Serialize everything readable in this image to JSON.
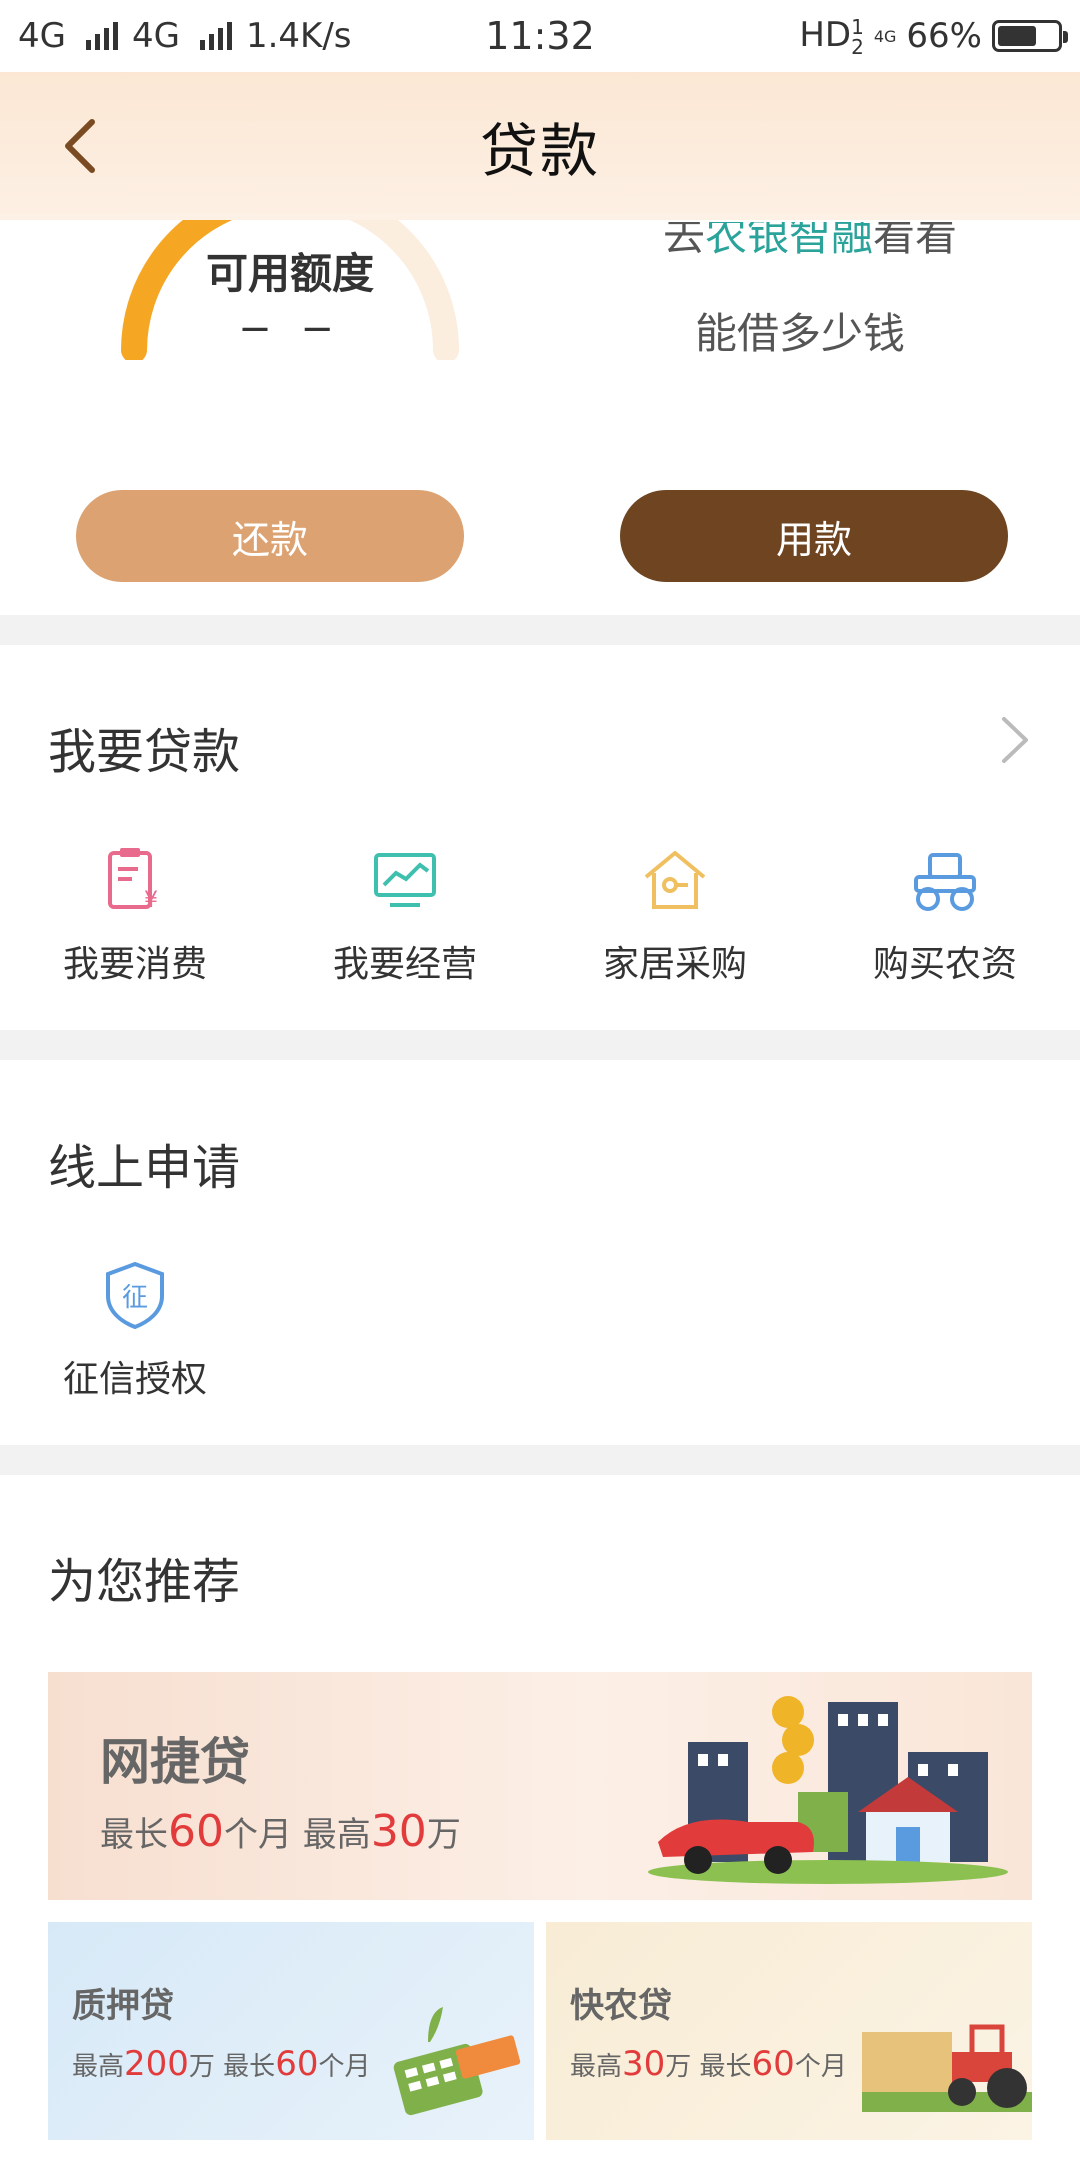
{
  "status_bar": {
    "network1": "4G",
    "network2": "4G",
    "speed": "1.4K/s",
    "time": "11:32",
    "hd": "HD",
    "hd_sup": "1",
    "hd_sub": "2",
    "net_small": "4G",
    "battery": "66%"
  },
  "header": {
    "title": "贷款"
  },
  "credit": {
    "label": "可用额度",
    "value": "− −",
    "hint_prefix": "去",
    "hint_brand": "农银智融",
    "hint_suffix": "看看",
    "hint_line2": "能借多少钱",
    "repay_label": "还款",
    "use_label": "用款",
    "repay_color": "#dca272",
    "use_color": "#6e4421"
  },
  "loan_section": {
    "title": "我要贷款",
    "items": [
      {
        "label": "我要消费",
        "icon": "consume-icon",
        "color": "#e86a8c"
      },
      {
        "label": "我要经营",
        "icon": "business-chart-icon",
        "color": "#3fbfae"
      },
      {
        "label": "家居采购",
        "icon": "house-key-icon",
        "color": "#f0c060"
      },
      {
        "label": "购买农资",
        "icon": "tractor-icon",
        "color": "#5a9be0"
      }
    ]
  },
  "online_section": {
    "title": "线上申请",
    "items": [
      {
        "label": "征信授权",
        "icon": "credit-shield-icon",
        "icon_text": "征",
        "color": "#5a9be0"
      }
    ]
  },
  "recommend_section": {
    "title": "为您推荐",
    "main": {
      "title": "网捷贷",
      "p1": "最长",
      "n1": "60",
      "p2": "个月 最高",
      "n2": "30",
      "p3": "万"
    },
    "left": {
      "title": "质押贷",
      "p1": "最高",
      "n1": "200",
      "p2": "万  最长",
      "n2": "60",
      "p3": "个月"
    },
    "right": {
      "title": "快农贷",
      "p1": "最高",
      "n1": "30",
      "p2": "万  最长",
      "n2": "60",
      "p3": "个月"
    }
  }
}
